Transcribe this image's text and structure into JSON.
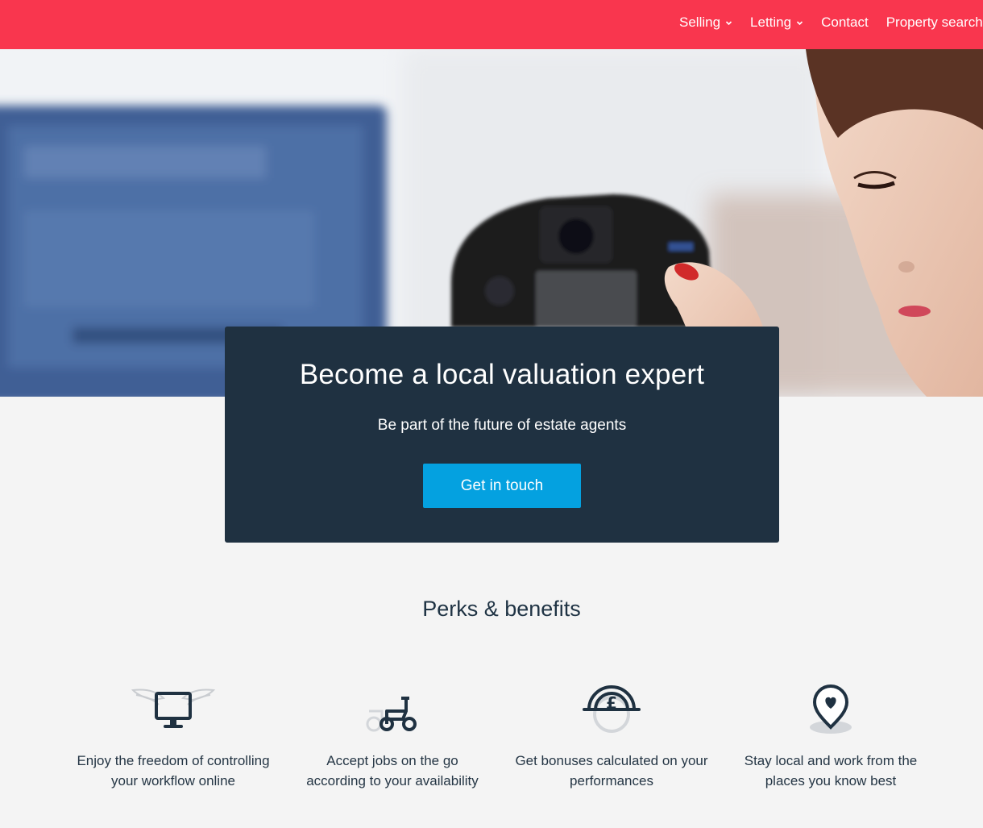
{
  "nav": {
    "items": [
      {
        "label": "Selling",
        "has_dropdown": true
      },
      {
        "label": "Letting",
        "has_dropdown": true
      },
      {
        "label": "Contact",
        "has_dropdown": false
      },
      {
        "label": "Property search",
        "has_dropdown": false
      }
    ]
  },
  "hero": {
    "image": "photographer-with-camera-and-laptop",
    "title": "Become a local valuation expert",
    "subtitle": "Be part of the future of estate agents",
    "cta_label": "Get in touch"
  },
  "perks": {
    "heading": "Perks & benefits",
    "items": [
      {
        "icon": "winged-monitor-icon",
        "text": "Enjoy the freedom of controlling your workflow online"
      },
      {
        "icon": "bicycle-icon",
        "text": "Accept jobs on the go according to your availability"
      },
      {
        "icon": "pound-coin-icon",
        "text": "Get bonuses calculated on your performances"
      },
      {
        "icon": "location-heart-icon",
        "text": "Stay local and work from the places you know best"
      }
    ]
  },
  "colors": {
    "brand_red": "#f9364e",
    "navy": "#1f3141",
    "cta_blue": "#04a1e0",
    "page_bg": "#f4f4f4"
  }
}
